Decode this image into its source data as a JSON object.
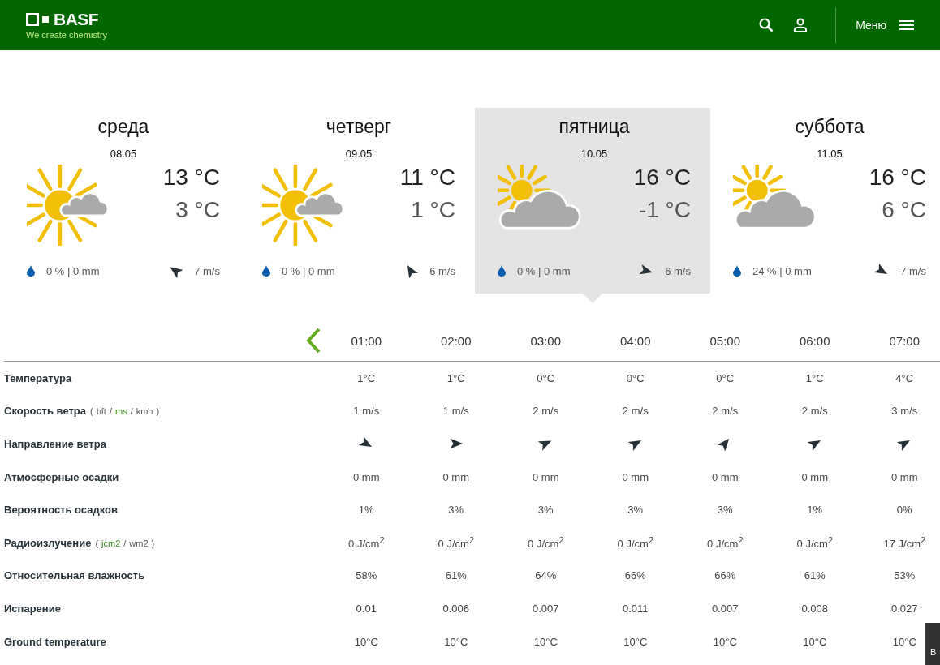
{
  "header": {
    "logo": "BASF",
    "tagline": "We create chemistry",
    "menu_label": "Меню"
  },
  "days": [
    {
      "kind": "sunny",
      "name": "среда",
      "date": "08.05",
      "high": "13 °C",
      "low": "3 °C",
      "rain": "0 % | 0 mm",
      "wind": "7 m/s",
      "selected": false
    },
    {
      "kind": "sunny",
      "name": "четверг",
      "date": "09.05",
      "high": "11 °C",
      "low": "1 °C",
      "rain": "0 % | 0 mm",
      "wind": "6 m/s",
      "selected": false
    },
    {
      "kind": "cloudy",
      "name": "пятница",
      "date": "10.05",
      "high": "16 °C",
      "low": "-1 °C",
      "rain": "0 % | 0 mm",
      "wind": "6 m/s",
      "selected": true
    },
    {
      "kind": "cloudy",
      "name": "суббота",
      "date": "11.05",
      "high": "16 °C",
      "low": "6 °C",
      "rain": "24 % | 0 mm",
      "wind": "7 m/s",
      "selected": false
    }
  ],
  "hours": [
    "01:00",
    "02:00",
    "03:00",
    "04:00",
    "05:00",
    "06:00",
    "07:00"
  ],
  "rows": [
    {
      "kind": "text",
      "label": "Температура",
      "cells": [
        "1°C",
        "1°C",
        "0°C",
        "0°C",
        "0°C",
        "1°C",
        "4°C"
      ]
    },
    {
      "kind": "text",
      "label": "Скорость ветра",
      "open": "(",
      "separator": "/",
      "close": ")",
      "units": [
        {
          "label": "bft",
          "selected": false
        },
        {
          "label": "ms",
          "selected": true
        },
        {
          "label": "kmh",
          "selected": false
        }
      ],
      "cells": [
        "1 m/s",
        "1 m/s",
        "2 m/s",
        "2 m/s",
        "2 m/s",
        "2 m/s",
        "3 m/s"
      ]
    },
    {
      "kind": "arrows",
      "label": "Направление ветра"
    },
    {
      "kind": "text",
      "label": "Атмосферные осадки",
      "cells": [
        "0 mm",
        "0 mm",
        "0 mm",
        "0 mm",
        "0 mm",
        "0 mm",
        "0 mm"
      ]
    },
    {
      "kind": "text",
      "label": "Вероятность осадков",
      "cells": [
        "1%",
        "3%",
        "3%",
        "3%",
        "3%",
        "1%",
        "0%"
      ]
    },
    {
      "kind": "text",
      "label": "Радиоизлучение",
      "open": "(",
      "separator": "/",
      "close": ")",
      "units": [
        {
          "label": "jcm2",
          "selected": true
        },
        {
          "label": "wm2",
          "selected": false
        }
      ],
      "cells": [
        "0 J/cm$^{2}$",
        "0 J/cm$^{2}$",
        "0 J/cm$^{2}$",
        "0 J/cm$^{2}$",
        "0 J/cm$^{2}$",
        "0 J/cm$^{2}$",
        "17 J/cm$^{2}$"
      ]
    },
    {
      "kind": "text",
      "label": "Относительная влажность",
      "cells": [
        "58%",
        "61%",
        "64%",
        "66%",
        "66%",
        "61%",
        "53%"
      ]
    },
    {
      "kind": "text",
      "label": "Испарение",
      "cells": [
        "0.01",
        "0.006",
        "0.007",
        "0.011",
        "0.007",
        "0.008",
        "0.027"
      ]
    },
    {
      "kind": "text",
      "label": "Ground temperature",
      "cells": [
        "10°C",
        "10°C",
        "10°C",
        "10°C",
        "10°C",
        "10°C",
        "10°C"
      ]
    }
  ],
  "corner_button": "В"
}
